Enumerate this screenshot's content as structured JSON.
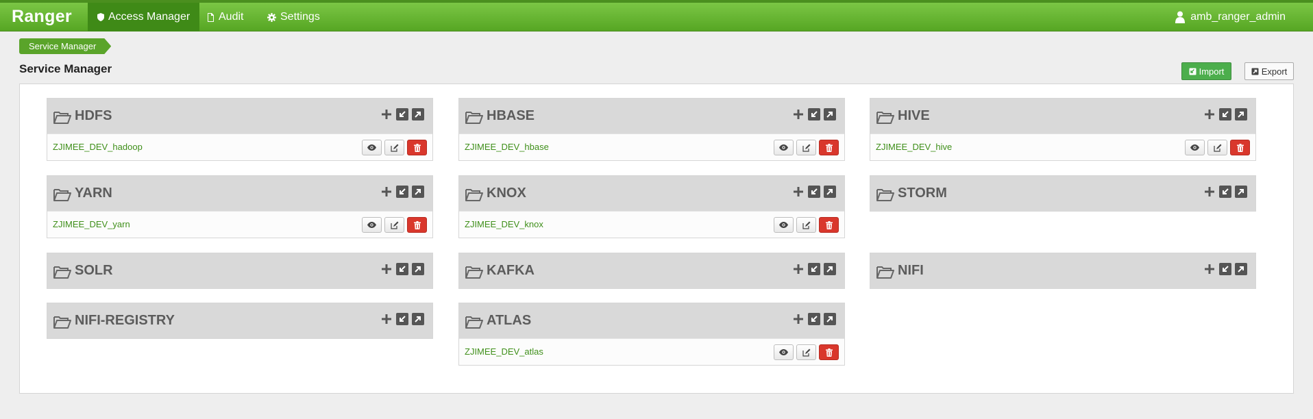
{
  "navbar": {
    "brand": "Ranger",
    "items": [
      {
        "label": "Access Manager",
        "icon": "shield-icon",
        "active": true
      },
      {
        "label": "Audit",
        "icon": "file-icon",
        "active": false
      },
      {
        "label": "Settings",
        "icon": "gear-icon",
        "active": false
      }
    ],
    "user": "amb_ranger_admin"
  },
  "breadcrumb": "Service Manager",
  "page_title": "Service Manager",
  "toolbar": {
    "import_label": "Import",
    "export_label": "Export"
  },
  "colors": {
    "brand_green": "#5aa42a",
    "delete_red": "#d9372c",
    "link_green": "#3f8f1a"
  },
  "services": [
    {
      "name": "HDFS",
      "instances": [
        "ZJIMEE_DEV_hadoop"
      ]
    },
    {
      "name": "HBASE",
      "instances": [
        "ZJIMEE_DEV_hbase"
      ]
    },
    {
      "name": "HIVE",
      "instances": [
        "ZJIMEE_DEV_hive"
      ]
    },
    {
      "name": "YARN",
      "instances": [
        "ZJIMEE_DEV_yarn"
      ]
    },
    {
      "name": "KNOX",
      "instances": [
        "ZJIMEE_DEV_knox"
      ]
    },
    {
      "name": "STORM",
      "instances": []
    },
    {
      "name": "SOLR",
      "instances": []
    },
    {
      "name": "KAFKA",
      "instances": []
    },
    {
      "name": "NIFI",
      "instances": []
    },
    {
      "name": "NIFI-REGISTRY",
      "instances": []
    },
    {
      "name": "ATLAS",
      "instances": [
        "ZJIMEE_DEV_atlas"
      ]
    }
  ]
}
